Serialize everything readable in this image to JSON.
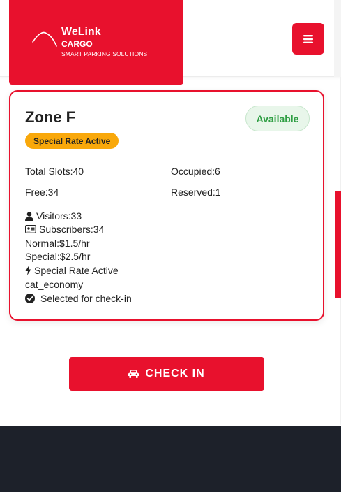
{
  "brand": {
    "name": "WeLink",
    "sub": "CARGO",
    "tagline": "SMART PARKING SOLUTIONS",
    "color": "#e8112d"
  },
  "menu_icon": "hamburger-icon",
  "zone": {
    "title": "Zone F",
    "status": "Available",
    "rate_badge": "Special Rate Active",
    "stats": {
      "total": "Total Slots:40",
      "occupied": "Occupied:6",
      "free": "Free:34",
      "reserved": "Reserved:1"
    },
    "details": {
      "visitors": "Visitors:33",
      "subscribers": "Subscribers:34",
      "normal": "Normal:$1.5/hr",
      "special": "Special:$2.5/hr",
      "special_rate": "Special Rate Active",
      "category": "cat_economy",
      "selected": "Selected for check-in"
    }
  },
  "checkin_label": "CHECK IN",
  "colors": {
    "accent": "#e8112d",
    "available_text": "#2e9e43",
    "available_bg": "#e8f6ea",
    "rate_badge": "#f9a80b",
    "footer": "#1d212a"
  }
}
